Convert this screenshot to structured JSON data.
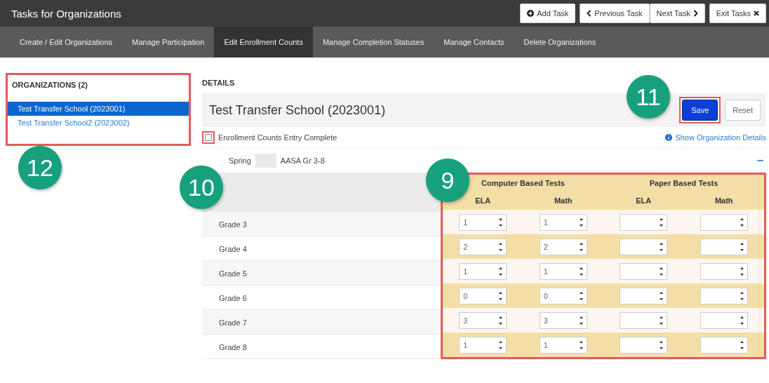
{
  "window": {
    "title": "Tasks for Organizations"
  },
  "toolbar": {
    "add_task": "Add Task",
    "previous_task": "Previous Task",
    "next_task": "Next Task",
    "exit_tasks": "Exit Tasks"
  },
  "tabs": [
    {
      "label": "Create / Edit Organizations",
      "selected": false
    },
    {
      "label": "Manage Participation",
      "selected": false
    },
    {
      "label": "Edit Enrollment Counts",
      "selected": true
    },
    {
      "label": "Manage Completion Statuses",
      "selected": false
    },
    {
      "label": "Manage Contacts",
      "selected": false
    },
    {
      "label": "Delete Organizations",
      "selected": false
    }
  ],
  "organizations": {
    "title": "ORGANIZATIONS (2)",
    "items": [
      {
        "label": "Test Transfer School (2023001)",
        "selected": true
      },
      {
        "label": "Test Transfer School2 (2023002)",
        "selected": false
      }
    ]
  },
  "details": {
    "title": "DETAILS",
    "org_name": "Test Transfer School (2023001)",
    "save": "Save",
    "reset": "Reset",
    "entry_complete": {
      "label": "Enrollment Counts Entry Complete",
      "checked": false
    },
    "show_details": "Show Organization Details",
    "section": {
      "prefix": "Spring",
      "name": "AASA Gr 3-8",
      "collapse": "−",
      "expanded": true
    },
    "groups": [
      {
        "title": "Computer Based Tests",
        "columns": [
          "ELA",
          "Math"
        ]
      },
      {
        "title": "Paper Based Tests",
        "columns": [
          "ELA",
          "Math"
        ]
      }
    ],
    "rows": [
      {
        "label": "Grade 3",
        "values": [
          "1",
          "1"
        ]
      },
      {
        "label": "Grade 4",
        "values": [
          "2",
          "2"
        ]
      },
      {
        "label": "Grade 5",
        "values": [
          "1",
          "1"
        ]
      },
      {
        "label": "Grade 6",
        "values": [
          "0",
          "0"
        ]
      },
      {
        "label": "Grade 7",
        "values": [
          "3",
          "3"
        ]
      },
      {
        "label": "Grade 8",
        "values": [
          "1",
          "1"
        ]
      }
    ]
  },
  "callouts": [
    {
      "kind": "org-list",
      "label": "12"
    },
    {
      "kind": "checkbox",
      "label": "10"
    },
    {
      "kind": "save",
      "label": "11"
    },
    {
      "kind": "table",
      "label": "9"
    }
  ]
}
